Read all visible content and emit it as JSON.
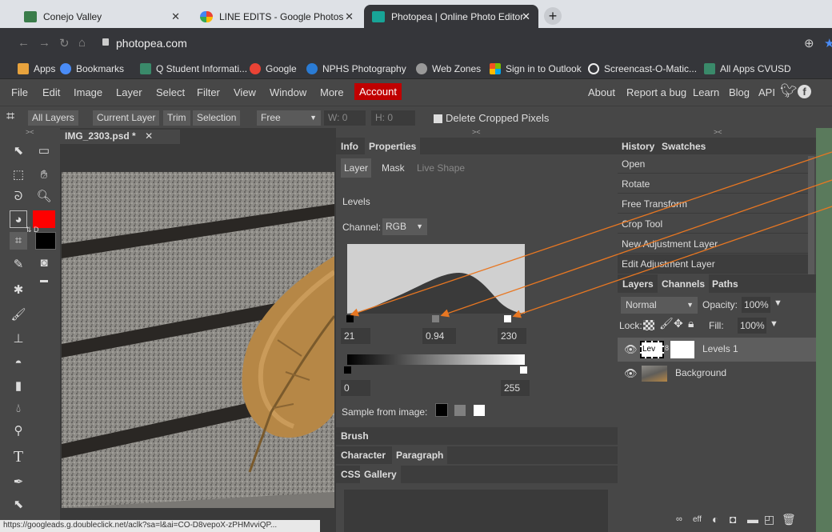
{
  "browser": {
    "tabs": [
      {
        "title": "Conejo Valley",
        "color": "#3a7c4a"
      },
      {
        "title": "LINE EDITS - Google Photos",
        "color": "#ea4335"
      },
      {
        "title": "Photopea | Online Photo Editor",
        "color": "#18a497"
      }
    ],
    "new_tab": "+",
    "close_glyph": "✕",
    "url": "photopea.com",
    "bookmarks": [
      {
        "label": "Apps",
        "color": "#e8a33d"
      },
      {
        "label": "Bookmarks",
        "color": "#4a8cf7"
      },
      {
        "label": "Q Student Informati...",
        "color": "#3a8a6a"
      },
      {
        "label": "Google",
        "color": "#ea4335"
      },
      {
        "label": "NPHS Photography",
        "color": "#2a7bd4"
      },
      {
        "label": "Web Zones",
        "color": "#999999"
      },
      {
        "label": "Sign in to Outlook",
        "color": "#f25022"
      },
      {
        "label": "Screencast-O-Matic...",
        "color": "#ffffff"
      },
      {
        "label": "All Apps CVUSD",
        "color": "#3a8a6a"
      }
    ],
    "status_url": "https://googleads.g.doubleclick.net/aclk?sa=l&ai=CO-D8vepoX-zPHMvviQP..."
  },
  "menu": {
    "items": [
      "File",
      "Edit",
      "Image",
      "Layer",
      "Select",
      "Filter",
      "View",
      "Window",
      "More"
    ],
    "account": "Account",
    "right_items": [
      "About",
      "Report a bug",
      "Learn",
      "Blog",
      "API"
    ]
  },
  "options": {
    "buttons": [
      "All Layers",
      "Current Layer",
      "Trim",
      "Selection"
    ],
    "ratio": "Free",
    "w": "W: 0",
    "h": "H: 0",
    "delete_cropped": "Delete Cropped Pixels"
  },
  "document": {
    "tab": "IMG_2303.psd *"
  },
  "tool_colors": {
    "foreground": "#ff0000",
    "background": "#000000"
  },
  "properties": {
    "tabs": [
      "Info",
      "Properties"
    ],
    "subtabs": [
      "Layer",
      "Mask",
      "Live Shape"
    ],
    "title": "Levels",
    "channel_label": "Channel:",
    "channel": "RGB",
    "input_black": "21",
    "input_gamma": "0.94",
    "input_white": "230",
    "output_black": "0",
    "output_white": "255",
    "sample_label": "Sample from image:"
  },
  "collapsed_panels": [
    "Brush",
    "Character",
    "Paragraph",
    "CSS",
    "Gallery"
  ],
  "history": {
    "tabs": [
      "History",
      "Swatches"
    ],
    "items": [
      "Open",
      "Rotate",
      "Free Transform",
      "Crop Tool",
      "New Adjustment Layer",
      "Edit Adjustment Layer"
    ]
  },
  "layers": {
    "tabs": [
      "Layers",
      "Channels",
      "Paths"
    ],
    "blend": "Normal",
    "opacity_label": "Opacity:",
    "opacity": "100%",
    "lock_label": "Lock:",
    "fill_label": "Fill:",
    "fill": "100%",
    "items": [
      {
        "name": "Levels 1",
        "thumb": "Lev"
      },
      {
        "name": "Background",
        "thumb": ""
      }
    ]
  }
}
